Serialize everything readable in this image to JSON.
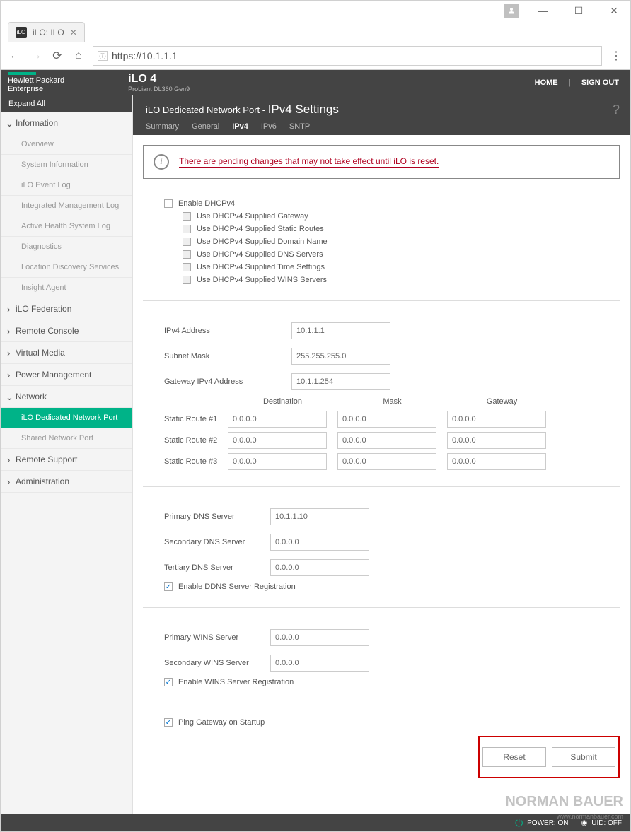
{
  "browser": {
    "tab_title": "iLO: ILO",
    "url": "https://10.1.1.1"
  },
  "header": {
    "brand1": "Hewlett Packard",
    "brand2": "Enterprise",
    "product": "iLO 4",
    "model": "ProLiant DL360 Gen9",
    "links": {
      "home": "HOME",
      "signout": "SIGN OUT"
    }
  },
  "sidebar": {
    "expand_all": "Expand All",
    "sections": [
      {
        "label": "Information",
        "open": true,
        "items": [
          "Overview",
          "System Information",
          "iLO Event Log",
          "Integrated Management Log",
          "Active Health System Log",
          "Diagnostics",
          "Location Discovery Services",
          "Insight Agent"
        ]
      },
      {
        "label": "iLO Federation"
      },
      {
        "label": "Remote Console"
      },
      {
        "label": "Virtual Media"
      },
      {
        "label": "Power Management"
      },
      {
        "label": "Network",
        "open": true,
        "items": [
          "iLO Dedicated Network Port",
          "Shared Network Port"
        ],
        "active_item": 0
      },
      {
        "label": "Remote Support"
      },
      {
        "label": "Administration"
      }
    ]
  },
  "page": {
    "breadcrumb_left": "iLO Dedicated Network Port - ",
    "breadcrumb_right": "IPv4 Settings",
    "tabs": [
      "Summary",
      "General",
      "IPv4",
      "IPv6",
      "SNTP"
    ],
    "active_tab": 2
  },
  "alert": {
    "text": "There are pending changes that may not take effect until iLO is reset."
  },
  "dhcp": {
    "enable": "Enable DHCPv4",
    "options": [
      "Use DHCPv4 Supplied Gateway",
      "Use DHCPv4 Supplied Static Routes",
      "Use DHCPv4 Supplied Domain Name",
      "Use DHCPv4 Supplied DNS Servers",
      "Use DHCPv4 Supplied Time Settings",
      "Use DHCPv4 Supplied WINS Servers"
    ]
  },
  "addr": {
    "labels": {
      "ip": "IPv4 Address",
      "mask": "Subnet Mask",
      "gw": "Gateway IPv4 Address"
    },
    "values": {
      "ip": "10.1.1.1",
      "mask": "255.255.255.0",
      "gw": "10.1.1.254"
    }
  },
  "routes": {
    "headers": {
      "dest": "Destination",
      "mask": "Mask",
      "gw": "Gateway"
    },
    "rows": [
      {
        "label": "Static Route #1",
        "dest": "0.0.0.0",
        "mask": "0.0.0.0",
        "gw": "0.0.0.0"
      },
      {
        "label": "Static Route #2",
        "dest": "0.0.0.0",
        "mask": "0.0.0.0",
        "gw": "0.0.0.0"
      },
      {
        "label": "Static Route #3",
        "dest": "0.0.0.0",
        "mask": "0.0.0.0",
        "gw": "0.0.0.0"
      }
    ]
  },
  "dns": {
    "labels": {
      "primary": "Primary DNS Server",
      "secondary": "Secondary DNS Server",
      "tertiary": "Tertiary DNS Server"
    },
    "values": {
      "primary": "10.1.1.10",
      "secondary": "0.0.0.0",
      "tertiary": "0.0.0.0"
    },
    "ddns_label": "Enable DDNS Server Registration"
  },
  "wins": {
    "labels": {
      "primary": "Primary WINS Server",
      "secondary": "Secondary WINS Server"
    },
    "values": {
      "primary": "0.0.0.0",
      "secondary": "0.0.0.0"
    },
    "reg_label": "Enable WINS Server Registration"
  },
  "ping": {
    "label": "Ping Gateway on Startup"
  },
  "actions": {
    "reset": "Reset",
    "submit": "Submit"
  },
  "footer": {
    "power": "POWER: ON",
    "uid": "UID: OFF"
  },
  "watermark": {
    "brand": "NORMAN BAUER",
    "url": "www.normanbauer.com"
  }
}
